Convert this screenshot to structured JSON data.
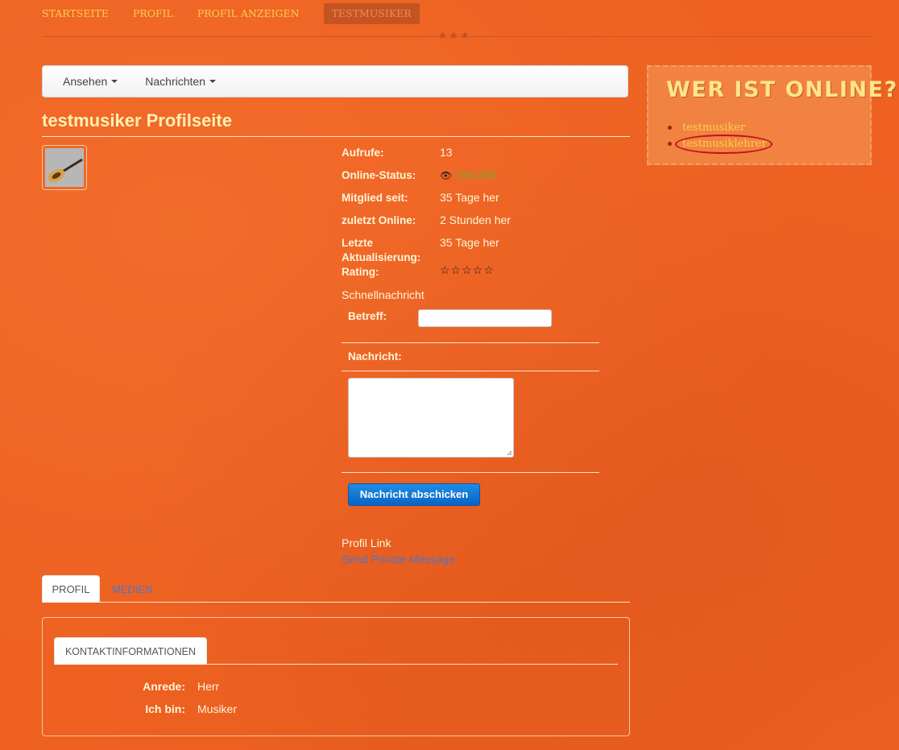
{
  "topnav": {
    "items": [
      "STARTSEITE",
      "PROFIL",
      "PROFIL ANZEIGEN"
    ],
    "active": "TESTMUSIKER"
  },
  "subnav": {
    "view_label": "Ansehen",
    "messages_label": "Nachrichten"
  },
  "profile": {
    "title": "testmusiker Profilseite",
    "fields": [
      {
        "label": "Aufrufe:",
        "value": "13"
      },
      {
        "label": "Online-Status:",
        "value": "ONLINE"
      },
      {
        "label": "Mitglied seit:",
        "value": "35 Tage her"
      },
      {
        "label": "zuletzt Online:",
        "value": "2 Stunden her"
      },
      {
        "label": "Letzte Aktualisierung:",
        "value": "35 Tage her"
      },
      {
        "label": "Rating:",
        "value": "☆☆☆☆☆"
      }
    ]
  },
  "quick_message": {
    "heading": "Schnellnachricht",
    "subject_label": "Betreff:",
    "message_label": "Nachricht:",
    "send_label": "Nachricht abschicken"
  },
  "links": {
    "profile_link": "Profil Link",
    "private_message": "Send Private Message"
  },
  "tabs": {
    "profile": "PROFIL",
    "media": "MEDIEN"
  },
  "contact": {
    "tab": "KONTAKTINFORMATIONEN",
    "rows": [
      {
        "label": "Anrede:",
        "value": "Herr"
      },
      {
        "label": "Ich bin:",
        "value": "Musiker"
      }
    ]
  },
  "sidebar": {
    "title": "WER IST ONLINE?",
    "users": [
      "testmusiker",
      "testmusiklehrer"
    ]
  },
  "colors": {
    "background": "#ee6121",
    "accent_yellow": "#f9d04a",
    "online_green": "#7da82a",
    "button_blue": "#0a64c4"
  }
}
